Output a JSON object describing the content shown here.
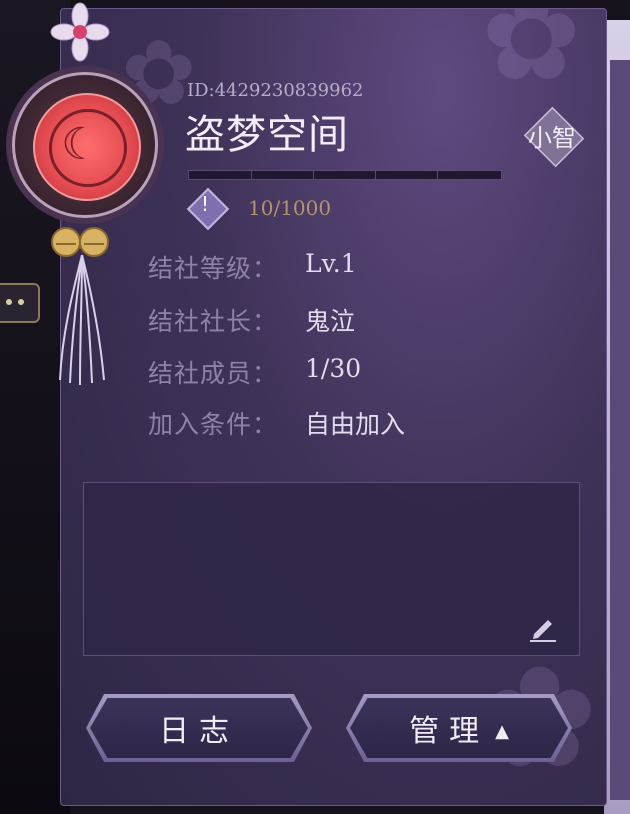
{
  "clan": {
    "id": "ID:4429230839962",
    "name": "盗梦空间",
    "progress_text": "10/1000",
    "progress": 0.01,
    "avatar_text": "小智"
  },
  "info": [
    {
      "label": "结社等级：",
      "value": "Lv.1"
    },
    {
      "label": "结社社长：",
      "value": "鬼泣"
    },
    {
      "label": "结社成员：",
      "value": "1/30"
    },
    {
      "label": "加入条件：",
      "value": "自由加入"
    }
  ],
  "notice": {
    "text": ""
  },
  "buttons": {
    "log": "日志",
    "manage": "管理",
    "manage_caret": "▲"
  },
  "icons": {
    "badge": "crescent-moon-emblem",
    "edit": "pencil-icon",
    "xp": "exclamation-diamond-icon"
  },
  "colors": {
    "panel": "#3f3258",
    "accent_gold": "#b3956a",
    "emblem_red": "#e24a4f"
  }
}
